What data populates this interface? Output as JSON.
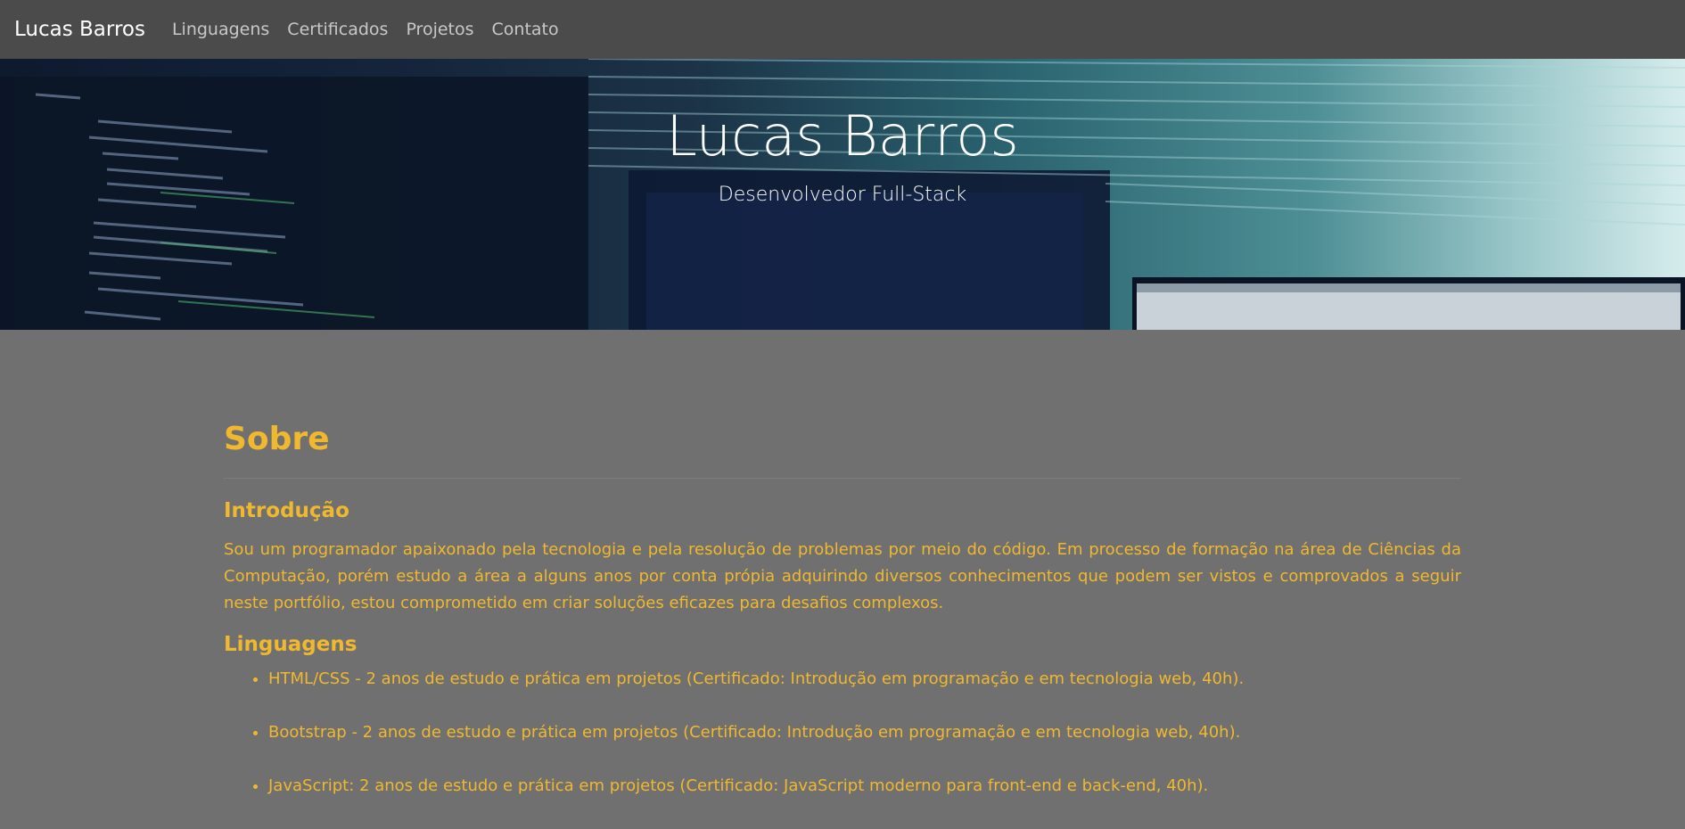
{
  "navbar": {
    "brand": "Lucas Barros",
    "links": [
      "Linguagens",
      "Certificados",
      "Projetos",
      "Contato"
    ]
  },
  "hero": {
    "title": "Lucas Barros",
    "subtitle": "Desenvolvedor Full-Stack"
  },
  "about": {
    "title": "Sobre",
    "intro_heading": "Introdução",
    "intro_text": "Sou um programador apaixonado pela tecnologia e pela resolução de problemas por meio do código. Em processo de formação na área de Ciências da Computação, porém estudo a área a alguns anos por conta própia adquirindo diversos conhecimentos que podem ser vistos e comprovados a seguir neste portfólio, estou comprometido em criar soluções eficazes para desafios complexos.",
    "languages_heading": "Linguagens",
    "languages": [
      "HTML/CSS - 2 anos de estudo e prática em projetos (Certificado: Introdução em programação e em tecnologia web, 40h).",
      "Bootstrap - 2 anos de estudo e prática em projetos (Certificado: Introdução em programação e em tecnologia web, 40h).",
      "JavaScript: 2 anos de estudo e prática em projetos (Certificado: JavaScript moderno para front-end e back-end, 40h)."
    ]
  },
  "colors": {
    "navbar_bg": "#4b4b4b",
    "page_bg": "#707070",
    "accent": "#f0b82e"
  }
}
